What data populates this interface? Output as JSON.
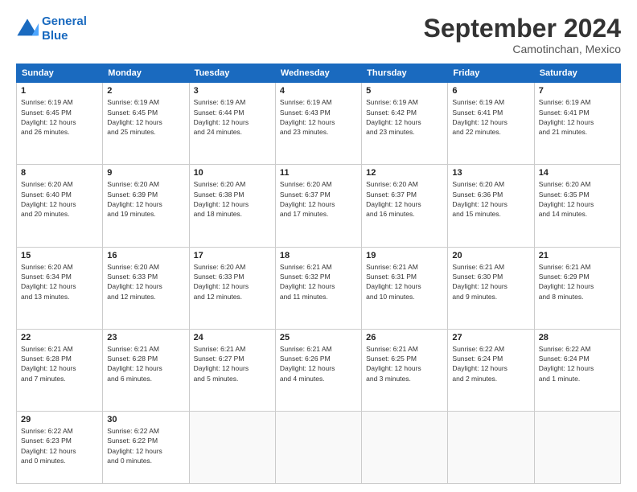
{
  "header": {
    "logo_line1": "General",
    "logo_line2": "Blue",
    "title": "September 2024",
    "subtitle": "Camotinchan, Mexico"
  },
  "weekdays": [
    "Sunday",
    "Monday",
    "Tuesday",
    "Wednesday",
    "Thursday",
    "Friday",
    "Saturday"
  ],
  "weeks": [
    [
      {
        "day": "1",
        "rise": "6:19 AM",
        "set": "6:45 PM",
        "daylight": "12 hours and 26 minutes."
      },
      {
        "day": "2",
        "rise": "6:19 AM",
        "set": "6:45 PM",
        "daylight": "12 hours and 25 minutes."
      },
      {
        "day": "3",
        "rise": "6:19 AM",
        "set": "6:44 PM",
        "daylight": "12 hours and 24 minutes."
      },
      {
        "day": "4",
        "rise": "6:19 AM",
        "set": "6:43 PM",
        "daylight": "12 hours and 23 minutes."
      },
      {
        "day": "5",
        "rise": "6:19 AM",
        "set": "6:42 PM",
        "daylight": "12 hours and 23 minutes."
      },
      {
        "day": "6",
        "rise": "6:19 AM",
        "set": "6:41 PM",
        "daylight": "12 hours and 22 minutes."
      },
      {
        "day": "7",
        "rise": "6:19 AM",
        "set": "6:41 PM",
        "daylight": "12 hours and 21 minutes."
      }
    ],
    [
      {
        "day": "8",
        "rise": "6:20 AM",
        "set": "6:40 PM",
        "daylight": "12 hours and 20 minutes."
      },
      {
        "day": "9",
        "rise": "6:20 AM",
        "set": "6:39 PM",
        "daylight": "12 hours and 19 minutes."
      },
      {
        "day": "10",
        "rise": "6:20 AM",
        "set": "6:38 PM",
        "daylight": "12 hours and 18 minutes."
      },
      {
        "day": "11",
        "rise": "6:20 AM",
        "set": "6:37 PM",
        "daylight": "12 hours and 17 minutes."
      },
      {
        "day": "12",
        "rise": "6:20 AM",
        "set": "6:37 PM",
        "daylight": "12 hours and 16 minutes."
      },
      {
        "day": "13",
        "rise": "6:20 AM",
        "set": "6:36 PM",
        "daylight": "12 hours and 15 minutes."
      },
      {
        "day": "14",
        "rise": "6:20 AM",
        "set": "6:35 PM",
        "daylight": "12 hours and 14 minutes."
      }
    ],
    [
      {
        "day": "15",
        "rise": "6:20 AM",
        "set": "6:34 PM",
        "daylight": "12 hours and 13 minutes."
      },
      {
        "day": "16",
        "rise": "6:20 AM",
        "set": "6:33 PM",
        "daylight": "12 hours and 12 minutes."
      },
      {
        "day": "17",
        "rise": "6:20 AM",
        "set": "6:33 PM",
        "daylight": "12 hours and 12 minutes."
      },
      {
        "day": "18",
        "rise": "6:21 AM",
        "set": "6:32 PM",
        "daylight": "12 hours and 11 minutes."
      },
      {
        "day": "19",
        "rise": "6:21 AM",
        "set": "6:31 PM",
        "daylight": "12 hours and 10 minutes."
      },
      {
        "day": "20",
        "rise": "6:21 AM",
        "set": "6:30 PM",
        "daylight": "12 hours and 9 minutes."
      },
      {
        "day": "21",
        "rise": "6:21 AM",
        "set": "6:29 PM",
        "daylight": "12 hours and 8 minutes."
      }
    ],
    [
      {
        "day": "22",
        "rise": "6:21 AM",
        "set": "6:28 PM",
        "daylight": "12 hours and 7 minutes."
      },
      {
        "day": "23",
        "rise": "6:21 AM",
        "set": "6:28 PM",
        "daylight": "12 hours and 6 minutes."
      },
      {
        "day": "24",
        "rise": "6:21 AM",
        "set": "6:27 PM",
        "daylight": "12 hours and 5 minutes."
      },
      {
        "day": "25",
        "rise": "6:21 AM",
        "set": "6:26 PM",
        "daylight": "12 hours and 4 minutes."
      },
      {
        "day": "26",
        "rise": "6:21 AM",
        "set": "6:25 PM",
        "daylight": "12 hours and 3 minutes."
      },
      {
        "day": "27",
        "rise": "6:22 AM",
        "set": "6:24 PM",
        "daylight": "12 hours and 2 minutes."
      },
      {
        "day": "28",
        "rise": "6:22 AM",
        "set": "6:24 PM",
        "daylight": "12 hours and 1 minute."
      }
    ],
    [
      {
        "day": "29",
        "rise": "6:22 AM",
        "set": "6:23 PM",
        "daylight": "12 hours and 0 minutes."
      },
      {
        "day": "30",
        "rise": "6:22 AM",
        "set": "6:22 PM",
        "daylight": "12 hours and 0 minutes."
      },
      null,
      null,
      null,
      null,
      null
    ]
  ]
}
